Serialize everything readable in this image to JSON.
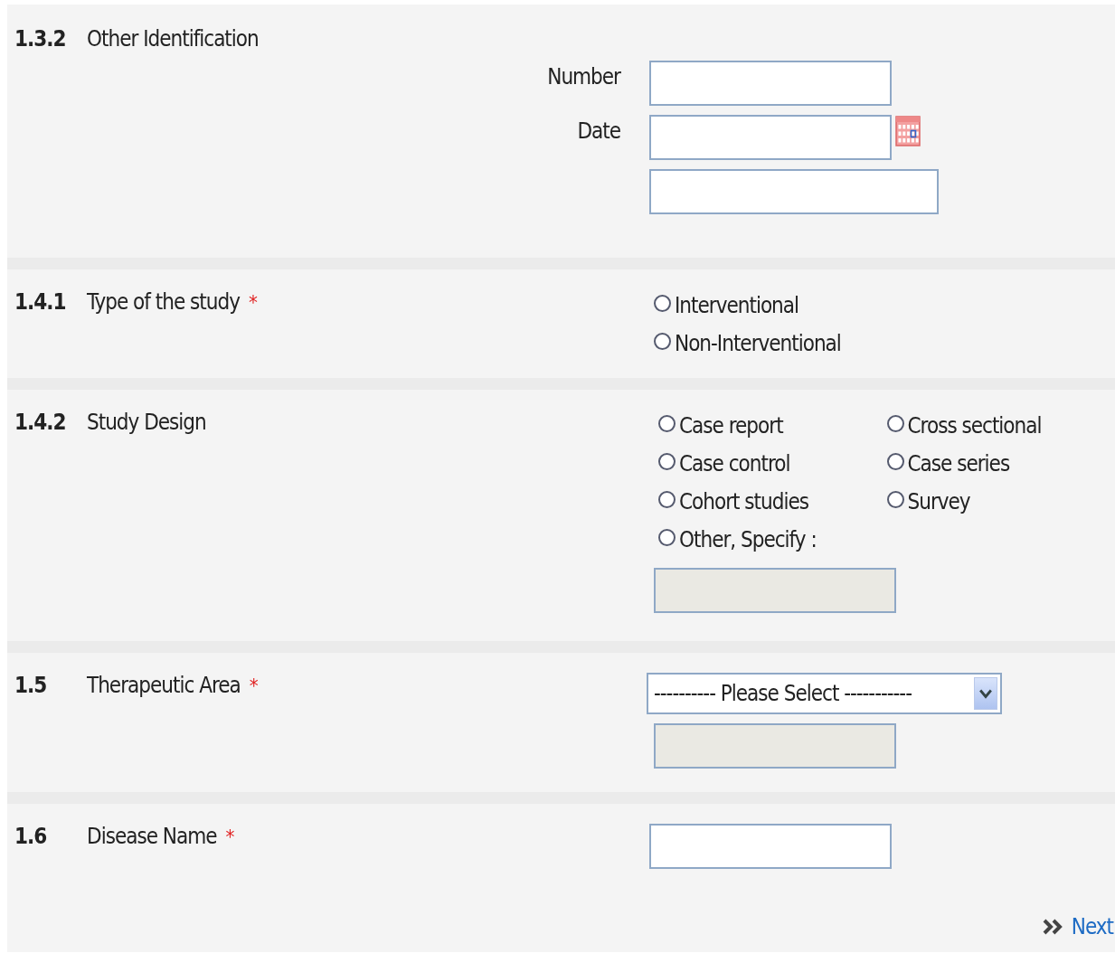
{
  "sections": [
    {
      "number": "1.3.2",
      "label": "Other Identification",
      "kind": "stacked",
      "controls": [
        {
          "kind": "text",
          "label": "Number"
        },
        {
          "kind": "date",
          "label": "Date"
        },
        {
          "kind": "wide-text"
        }
      ]
    },
    {
      "number": "1.4.1",
      "label": "Type of the study",
      "required_mark": "*",
      "kind": "inline",
      "controls": [
        {
          "kind": "radio-group",
          "columns": [
            [
              {
                "label": "Interventional",
                "selected": false
              },
              {
                "label": "Non-Interventional",
                "selected": false
              }
            ]
          ]
        }
      ]
    },
    {
      "number": "1.4.2",
      "label": "Study Design",
      "kind": "inline",
      "controls": [
        {
          "kind": "radio-group",
          "columns": [
            [
              {
                "label": "Case report",
                "selected": false
              },
              {
                "label": "Case control",
                "selected": false
              },
              {
                "label": "Cohort studies",
                "selected": false
              },
              {
                "label": "Other, Specify :",
                "selected": false
              }
            ],
            [
              {
                "label": "Cross sectional",
                "selected": false
              },
              {
                "label": "Case series",
                "selected": false
              },
              {
                "label": "Survey",
                "selected": false
              }
            ]
          ]
        },
        {
          "kind": "text",
          "disabled": true
        }
      ]
    },
    {
      "number": "1.5",
      "label": "Therapeutic Area",
      "required_mark": "*",
      "kind": "inline",
      "controls": [
        {
          "kind": "select",
          "value": "---------- Please Select -----------"
        },
        {
          "kind": "text",
          "disabled": true
        }
      ]
    },
    {
      "number": "1.6",
      "label": "Disease Name",
      "required_mark": "*",
      "kind": "inline",
      "controls": [
        {
          "kind": "text"
        }
      ]
    }
  ],
  "next_link": {
    "label": "Next"
  }
}
